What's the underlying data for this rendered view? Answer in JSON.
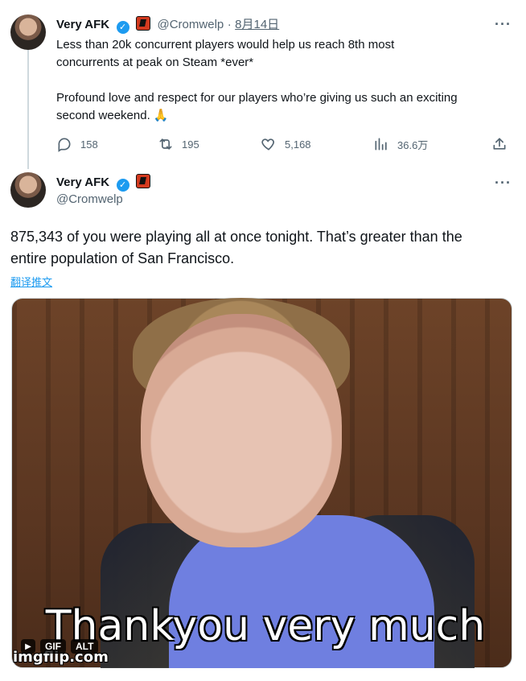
{
  "tweet1": {
    "author_name": "Very AFK",
    "handle": "@Cromwelp",
    "separator": "·",
    "date": "8月14日",
    "more": "···",
    "text_line1": "Less than 20k concurrent players would help us reach 8th most",
    "text_line2": "concurrents at peak on Steam *ever*",
    "text_line3": "Profound love and respect for our players who’re giving us such an exciting",
    "text_line4": "second weekend. 🙏",
    "actions": {
      "replies": "158",
      "retweets": "195",
      "likes": "5,168",
      "views": "36.6万"
    }
  },
  "tweet2": {
    "author_name": "Very AFK",
    "handle": "@Cromwelp",
    "more": "···",
    "text_line1": "875,343 of you were playing all at once tonight. That’s greater than the",
    "text_line2": "entire population of San Francisco.",
    "translate": "翻译推文",
    "media": {
      "caption": "Thankyou very much",
      "watermark": "imgflip.com",
      "gif_label": "GIF",
      "alt_label": "ALT",
      "play_icon": "play-icon"
    }
  },
  "icons": {
    "verified": "verified-badge-icon",
    "affiliation": "affiliate-badge-icon",
    "reply": "reply-icon",
    "retweet": "retweet-icon",
    "like": "heart-icon",
    "views": "views-icon",
    "share": "share-icon"
  },
  "colors": {
    "brand_blue": "#1d9bf0",
    "text_primary": "#0f1419",
    "text_secondary": "#536471"
  }
}
